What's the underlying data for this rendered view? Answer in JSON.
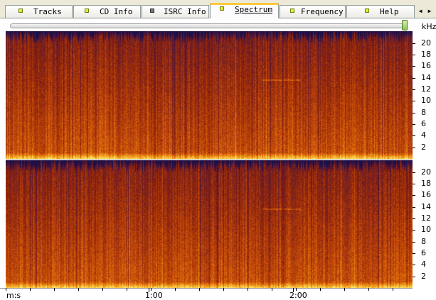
{
  "tabs": [
    {
      "label": "Tracks",
      "led": "on",
      "active": false
    },
    {
      "label": "CD Info",
      "led": "on",
      "active": false
    },
    {
      "label": "ISRC Info",
      "led": "off",
      "active": false
    },
    {
      "label": "Spectrum",
      "led": "on",
      "active": true
    },
    {
      "label": "Frequency",
      "led": "on",
      "active": false
    },
    {
      "label": "Help",
      "led": "on",
      "active": false
    }
  ],
  "tab_scroll": {
    "left_icon": "arrow-left-icon",
    "right_icon": "arrow-right-icon"
  },
  "frequency_unit": "kHz",
  "frequency_ticks": [
    "20",
    "18",
    "16",
    "14",
    "12",
    "10",
    "8",
    "6",
    "4",
    "2"
  ],
  "time_axis": {
    "unit_label": "m:s",
    "labels": [
      "1:00",
      "2:00"
    ]
  },
  "colors": {
    "spectrum_low": "#1e1046",
    "spectrum_mid": "#a63b05",
    "spectrum_high": "#ffe060",
    "active_tab_accent": "#ffc83c",
    "led_on": "#dfee30",
    "led_off": "#777777"
  }
}
